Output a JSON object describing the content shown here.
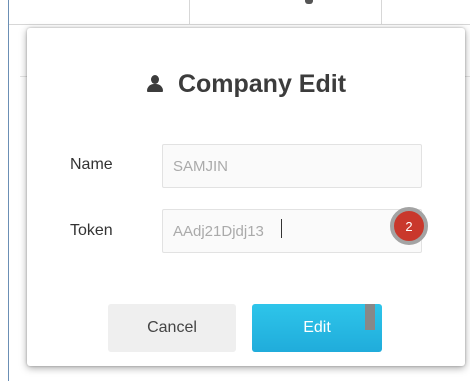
{
  "modal": {
    "title": "Company Edit",
    "title_icon": "user-icon",
    "fields": {
      "name": {
        "label": "Name",
        "value": "SAMJIN"
      },
      "token": {
        "label": "Token",
        "value": "AAdj21Djdj13"
      }
    },
    "step_badge": "2",
    "buttons": {
      "cancel": "Cancel",
      "edit": "Edit"
    }
  },
  "colors": {
    "primary_button": "#20acdb",
    "badge": "#c9382c",
    "title_text": "#3c3c3c"
  }
}
